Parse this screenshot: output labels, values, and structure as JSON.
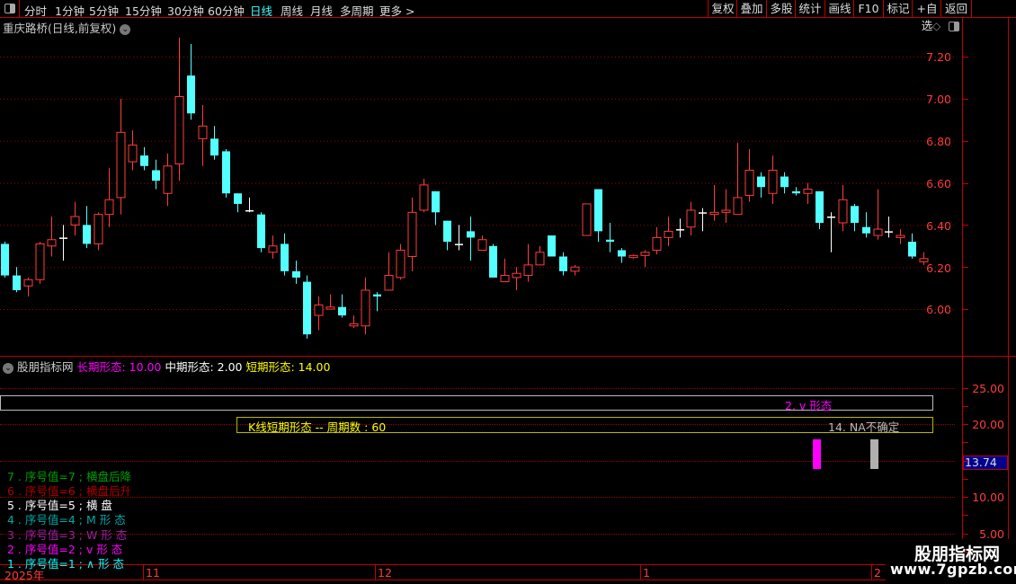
{
  "toolbar": {
    "periods": [
      "分时",
      "1分钟",
      "5分钟",
      "15分钟",
      "30分钟",
      "60分钟",
      "日线",
      "周线",
      "月线",
      "多周期",
      "更多 >"
    ],
    "active_period": "日线",
    "right_buttons": [
      "复权",
      "叠加",
      "多股",
      "统计",
      "画线",
      "F10",
      "标记",
      "+自选",
      "返回"
    ]
  },
  "main": {
    "title": "重庆路桥(日线,前复权)",
    "y_ticks": [
      "7.20",
      "7.00",
      "6.80",
      "6.60",
      "6.40",
      "6.20",
      "6.00"
    ]
  },
  "indicator": {
    "name": "股朋指标网",
    "long_label": "长期形态: 10.00",
    "mid_label": "中期形态: 2.00",
    "short_label": "短期形态: 14.00",
    "box1_text": "2. v 形态",
    "box2_left": "K线短期形态 -- 周期数 : 60",
    "box2_right": "14. NA不确定",
    "y_ticks": [
      "25.00",
      "20.00",
      "10.00",
      "5.00"
    ],
    "current_value": "13.74",
    "legend": [
      {
        "text": "7 . 序号值=7 ;  横盘后降",
        "color": "#00a000"
      },
      {
        "text": "6 . 序号值=6 ;  横盘后升",
        "color": "#b00000"
      },
      {
        "text": "5 . 序号值=5 ;  横 盘",
        "color": "#ffffff"
      },
      {
        "text": "4 . 序号值=4 ;  M 形 态",
        "color": "#00a8a8"
      },
      {
        "text": "3 . 序号值=3 ;  W 形 态",
        "color": "#a020a0"
      },
      {
        "text": "2 . 序号值=2 ;  v 形 态",
        "color": "#ff00ff"
      },
      {
        "text": "1 . 序号值=1 ;  ∧ 形 态",
        "color": "#00ffff"
      }
    ],
    "bar_colors": [
      "#ff00ff",
      "#b0b0b0"
    ]
  },
  "time_axis": [
    "2025年",
    "11",
    "12",
    "1",
    "2"
  ],
  "watermark": {
    "name": "股朋指标网",
    "url": "www.7gpzb.com"
  },
  "colors": {
    "up": "#ff3c3c",
    "down": "#54ffff",
    "flat": "#ffffff",
    "axis": "#c00000"
  },
  "chart_data": {
    "type": "candlestick",
    "ylim": [
      5.85,
      7.3
    ],
    "ohlc": [
      [
        6.31,
        6.32,
        6.15,
        6.16
      ],
      [
        6.16,
        6.2,
        6.08,
        6.09
      ],
      [
        6.11,
        6.15,
        6.06,
        6.14
      ],
      [
        6.14,
        6.32,
        6.12,
        6.31
      ],
      [
        6.3,
        6.44,
        6.25,
        6.33
      ],
      [
        6.34,
        6.4,
        6.23,
        6.34
      ],
      [
        6.4,
        6.51,
        6.35,
        6.44
      ],
      [
        6.4,
        6.49,
        6.29,
        6.31
      ],
      [
        6.31,
        6.46,
        6.28,
        6.45
      ],
      [
        6.45,
        6.67,
        6.39,
        6.52
      ],
      [
        6.53,
        7.0,
        6.45,
        6.84
      ],
      [
        6.7,
        6.85,
        6.66,
        6.78
      ],
      [
        6.73,
        6.77,
        6.66,
        6.68
      ],
      [
        6.66,
        6.71,
        6.57,
        6.61
      ],
      [
        6.55,
        6.74,
        6.49,
        6.68
      ],
      [
        6.69,
        7.29,
        6.61,
        7.01
      ],
      [
        7.11,
        7.26,
        6.9,
        6.93
      ],
      [
        6.81,
        6.97,
        6.68,
        6.87
      ],
      [
        6.81,
        6.87,
        6.71,
        6.73
      ],
      [
        6.75,
        6.76,
        6.53,
        6.55
      ],
      [
        6.55,
        6.55,
        6.46,
        6.5
      ],
      [
        6.47,
        6.53,
        6.46,
        6.47
      ],
      [
        6.45,
        6.46,
        6.27,
        6.29
      ],
      [
        6.27,
        6.35,
        6.24,
        6.3
      ],
      [
        6.31,
        6.36,
        6.16,
        6.18
      ],
      [
        6.18,
        6.23,
        6.12,
        6.15
      ],
      [
        6.13,
        6.16,
        5.86,
        5.88
      ],
      [
        5.97,
        6.06,
        5.9,
        6.02
      ],
      [
        6.0,
        6.07,
        6.0,
        6.01
      ],
      [
        6.01,
        6.07,
        5.96,
        5.97
      ],
      [
        5.92,
        5.97,
        5.91,
        5.93
      ],
      [
        5.92,
        6.15,
        5.88,
        6.09
      ],
      [
        6.07,
        6.08,
        5.99,
        6.06
      ],
      [
        6.09,
        6.27,
        6.09,
        6.16
      ],
      [
        6.15,
        6.31,
        6.14,
        6.28
      ],
      [
        6.25,
        6.53,
        6.18,
        6.46
      ],
      [
        6.47,
        6.62,
        6.46,
        6.59
      ],
      [
        6.56,
        6.56,
        6.4,
        6.46
      ],
      [
        6.42,
        6.42,
        6.28,
        6.32
      ],
      [
        6.31,
        6.4,
        6.28,
        6.31
      ],
      [
        6.37,
        6.44,
        6.23,
        6.34
      ],
      [
        6.28,
        6.35,
        6.28,
        6.33
      ],
      [
        6.3,
        6.31,
        6.15,
        6.15
      ],
      [
        6.13,
        6.24,
        6.13,
        6.16
      ],
      [
        6.15,
        6.2,
        6.09,
        6.17
      ],
      [
        6.16,
        6.31,
        6.13,
        6.21
      ],
      [
        6.21,
        6.3,
        6.21,
        6.27
      ],
      [
        6.35,
        6.35,
        6.25,
        6.25
      ],
      [
        6.25,
        6.27,
        6.16,
        6.18
      ],
      [
        6.18,
        6.21,
        6.16,
        6.2
      ],
      [
        6.35,
        6.5,
        6.35,
        6.5
      ],
      [
        6.57,
        6.57,
        6.32,
        6.37
      ],
      [
        6.33,
        6.41,
        6.27,
        6.32
      ],
      [
        6.28,
        6.29,
        6.22,
        6.25
      ],
      [
        6.245,
        6.26,
        6.24,
        6.255
      ],
      [
        6.255,
        6.28,
        6.2,
        6.27
      ],
      [
        6.28,
        6.39,
        6.26,
        6.34
      ],
      [
        6.34,
        6.44,
        6.3,
        6.37
      ],
      [
        6.38,
        6.43,
        6.34,
        6.38
      ],
      [
        6.39,
        6.51,
        6.35,
        6.47
      ],
      [
        6.46,
        6.48,
        6.37,
        6.46
      ],
      [
        6.45,
        6.59,
        6.42,
        6.46
      ],
      [
        6.46,
        6.57,
        6.41,
        6.47
      ],
      [
        6.45,
        6.79,
        6.45,
        6.53
      ],
      [
        6.54,
        6.76,
        6.51,
        6.66
      ],
      [
        6.63,
        6.65,
        6.53,
        6.58
      ],
      [
        6.55,
        6.73,
        6.5,
        6.66
      ],
      [
        6.63,
        6.65,
        6.55,
        6.58
      ],
      [
        6.56,
        6.58,
        6.54,
        6.55
      ],
      [
        6.55,
        6.6,
        6.5,
        6.57
      ],
      [
        6.56,
        6.56,
        6.38,
        6.41
      ],
      [
        6.44,
        6.46,
        6.27,
        6.44
      ],
      [
        6.41,
        6.59,
        6.37,
        6.52
      ],
      [
        6.49,
        6.5,
        6.37,
        6.41
      ],
      [
        6.39,
        6.46,
        6.34,
        6.36
      ],
      [
        6.35,
        6.57,
        6.33,
        6.38
      ],
      [
        6.37,
        6.44,
        6.34,
        6.37
      ],
      [
        6.34,
        6.38,
        6.31,
        6.35
      ],
      [
        6.32,
        6.36,
        6.24,
        6.25
      ],
      [
        6.225,
        6.27,
        6.21,
        6.24
      ]
    ]
  }
}
